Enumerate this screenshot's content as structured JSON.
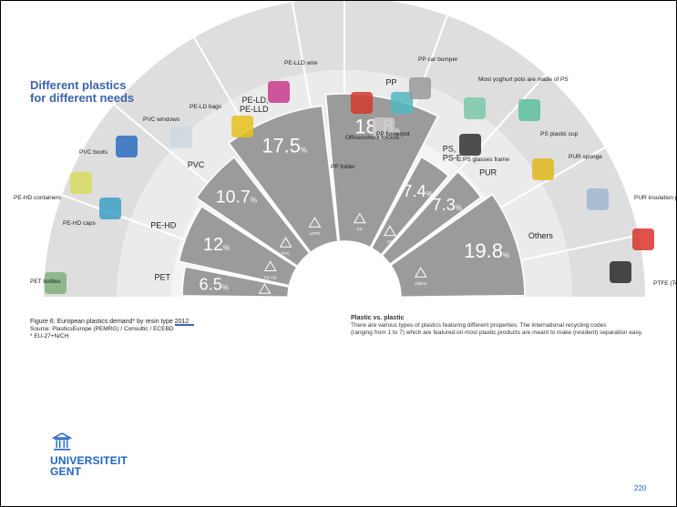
{
  "title_line1": "Different plastics",
  "title_line2": "for different needs",
  "chart_data": {
    "type": "pie",
    "variant": "half-ring sector chart",
    "title": "Different plastics for different needs",
    "unit": "%",
    "categories": [
      "PET",
      "PE-HD",
      "PVC",
      "PE-LD, PE-LLD",
      "PP",
      "PS, PS-E",
      "PUR",
      "Others"
    ],
    "values": [
      6.5,
      12,
      10.7,
      17.5,
      18.8,
      7.4,
      7.3,
      19.8
    ],
    "value_labels": [
      "6.5",
      "12",
      "10.7",
      "17.5",
      "18.8",
      "7.4",
      "7.3",
      "19.8"
    ],
    "recycling_codes": [
      "PET",
      "PE-HD",
      "PVC",
      "LDPE",
      "PP",
      "PS",
      "Others"
    ],
    "uses": [
      "PET bottles",
      "PE-HD caps",
      "PE-HD containers",
      "PVC boots",
      "PVC windows",
      "PE-LD bags",
      "PE-LLD wire",
      "Office/school folders",
      "PP flowerpot",
      "PP folder",
      "PP car bumper",
      "Most yoghurt pots are made of PS",
      "PS glasses frame",
      "PS plastic cup",
      "PUR sponge",
      "PUR insulation panels",
      "ABS bricks",
      "PTFE (Teflon) frying pan"
    ],
    "colors": {
      "sector": "#9b9b9b",
      "outer_ring": "#dedede",
      "mid_ring": "#ebebeb",
      "title": "#3b63ad",
      "logo": "#1e64c8"
    }
  },
  "caption": {
    "line1": "Figure 6: European plastics demand* by resin type 2012",
    "line2": "Source: PlasticsEurope (PEMRG) / Consultic / ECEBD",
    "line3": "* EU-27+N/CH"
  },
  "note": {
    "heading": "Plastic vs. plastic",
    "line1": "There are various types of plastics featuring different properties. The international recycling codes",
    "line2": "(ranging from 1 to 7) which are featured on most plastic products are meant to make (resident) separation easy."
  },
  "logo": {
    "line1": "UNIVERSITEIT",
    "line2": "GENT"
  },
  "page_number": "220"
}
